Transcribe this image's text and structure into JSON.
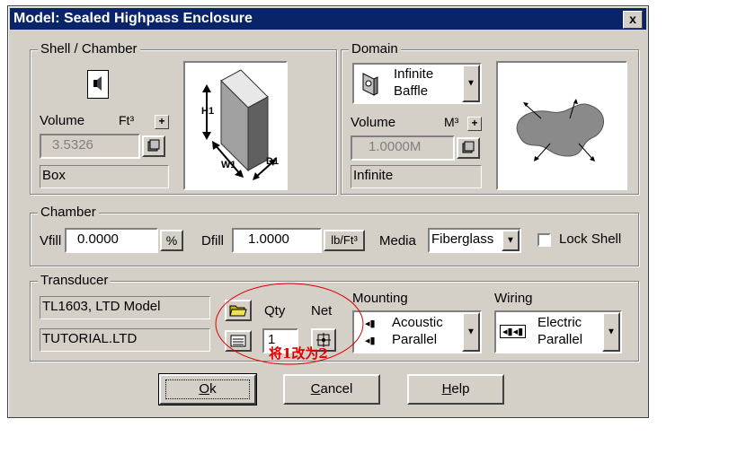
{
  "window": {
    "title": "Model: Sealed Highpass Enclosure",
    "close_label": "x"
  },
  "shell": {
    "group_label": "Shell / Chamber",
    "volume_label": "Volume",
    "unit_label": "Ft³",
    "plus_label": "+",
    "volume_value": "3.5326",
    "shape_value": "Box",
    "diagram_labels": {
      "h": "H1",
      "w": "W1",
      "d": "D1"
    }
  },
  "domain": {
    "group_label": "Domain",
    "combo_line1": "Infinite",
    "combo_line2": "Baffle",
    "volume_label": "Volume",
    "unit_label": "M³",
    "plus_label": "+",
    "volume_value": "1.0000M",
    "type_value": "Infinite"
  },
  "chamber": {
    "group_label": "Chamber",
    "vfill_label": "Vfill",
    "vfill_value": "0.0000",
    "vfill_unit": "%",
    "dfill_label": "Dfill",
    "dfill_value": "1.0000",
    "dfill_unit": "lb/Ft³",
    "media_label": "Media",
    "media_value": "Fiberglass",
    "lock_label": "Lock Shell"
  },
  "transducer": {
    "group_label": "Transducer",
    "model_value": "TL1603, LTD Model",
    "file_value": "TUTORIAL.LTD",
    "qty_label": "Qty",
    "qty_value": "1",
    "net_label": "Net",
    "mounting_label": "Mounting",
    "mounting_line1": "Acoustic",
    "mounting_line2": "Parallel",
    "wiring_label": "Wiring",
    "wiring_line1": "Electric",
    "wiring_line2": "Parallel"
  },
  "buttons": {
    "ok_underlined": "O",
    "ok_rest": "k",
    "cancel_underlined": "C",
    "cancel_rest": "ancel",
    "help_underlined": "H",
    "help_rest": "elp"
  },
  "annotation": {
    "text": "将1改为2",
    "color": "#e00000"
  }
}
